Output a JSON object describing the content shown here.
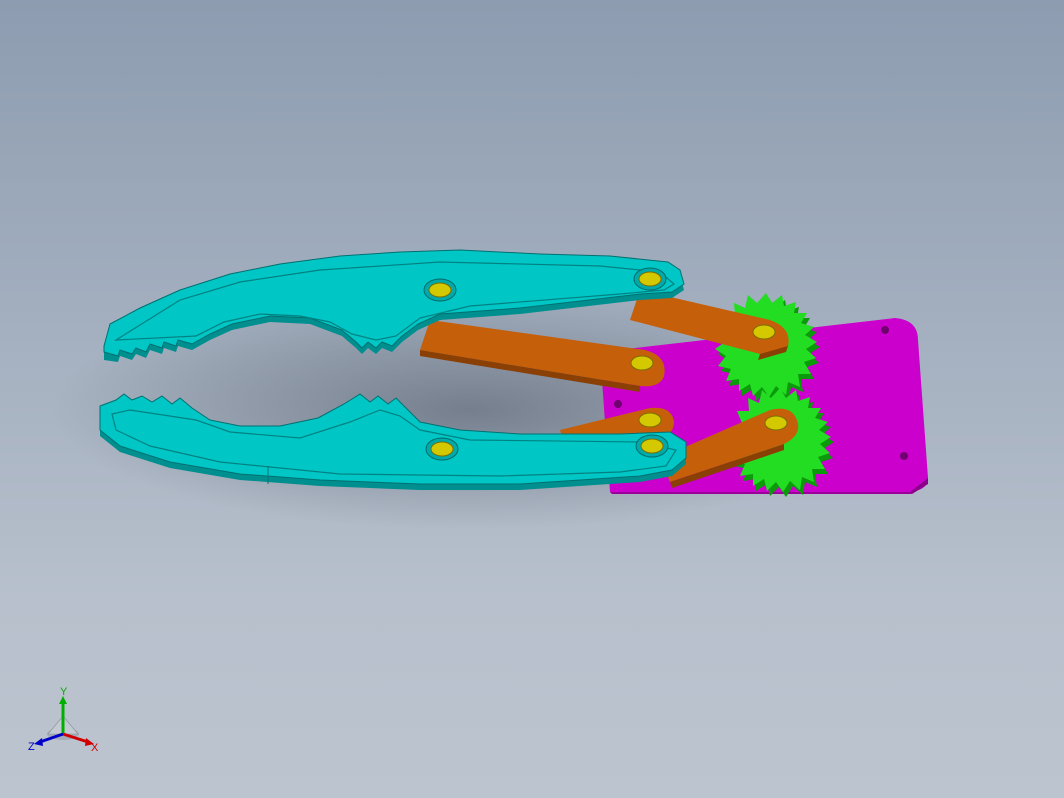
{
  "viewport": {
    "background_top": "#8d9cb0",
    "background_bottom": "#bcc4cf"
  },
  "model": {
    "parts": [
      {
        "name": "gripper-jaw-upper",
        "color": "#00bdbd"
      },
      {
        "name": "gripper-jaw-lower",
        "color": "#00bdbd"
      },
      {
        "name": "link-arm",
        "color": "#c65f0a"
      },
      {
        "name": "drive-gear",
        "color": "#1ee01e"
      },
      {
        "name": "base-plate",
        "color": "#cc00cc"
      },
      {
        "name": "pin",
        "color": "#d4c800"
      }
    ]
  },
  "triad": {
    "x_label": "X",
    "y_label": "Y",
    "z_label": "Z",
    "x_color": "#d00000",
    "y_color": "#00b000",
    "z_color": "#0000c8"
  }
}
